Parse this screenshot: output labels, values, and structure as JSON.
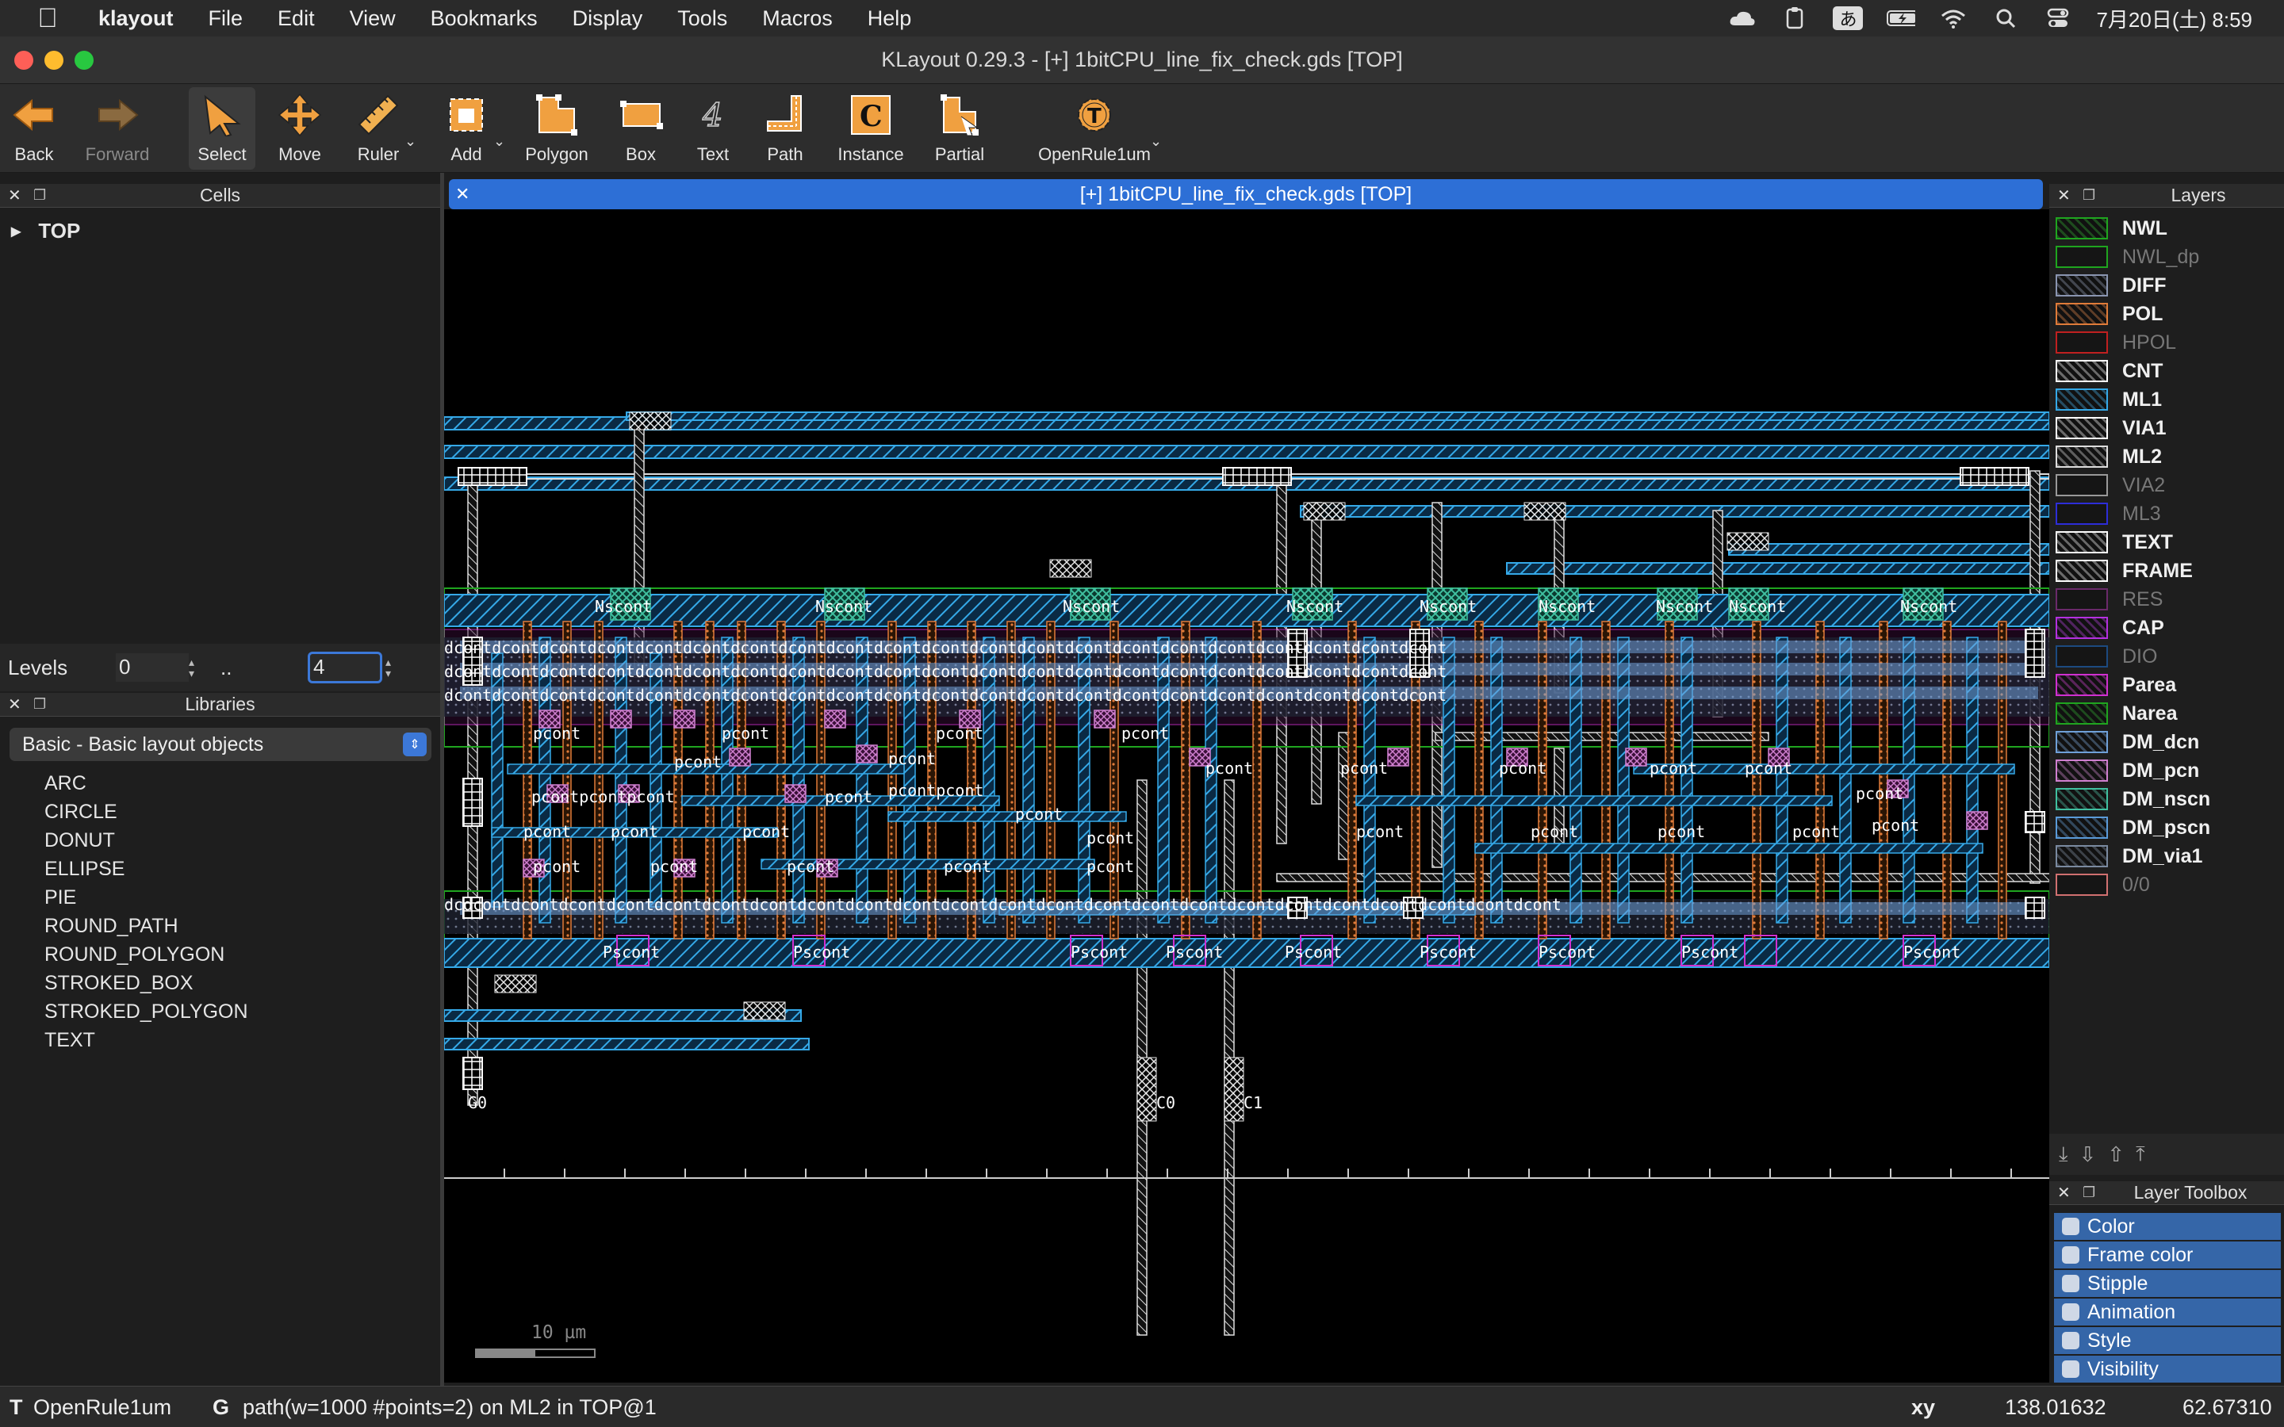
{
  "menubar": {
    "app": "klayout",
    "items": [
      "File",
      "Edit",
      "View",
      "Bookmarks",
      "Display",
      "Tools",
      "Macros",
      "Help"
    ],
    "ime": "あ",
    "clock": "7月20日(土) 8:59"
  },
  "window": {
    "title": "KLayout 0.29.3 - [+] 1bitCPU_line_fix_check.gds [TOP]"
  },
  "toolbar": {
    "back": "Back",
    "forward": "Forward",
    "select": "Select",
    "move": "Move",
    "ruler": "Ruler",
    "add": "Add",
    "polygon": "Polygon",
    "box": "Box",
    "text": "Text",
    "path": "Path",
    "instance": "Instance",
    "partial": "Partial",
    "technology": "OpenRule1um"
  },
  "cells": {
    "title": "Cells",
    "root": "TOP"
  },
  "levels": {
    "label": "Levels",
    "from": "0",
    "sep": "..",
    "to": "4"
  },
  "libraries": {
    "title": "Libraries",
    "selected": "Basic - Basic layout objects",
    "items": [
      "ARC",
      "CIRCLE",
      "DONUT",
      "ELLIPSE",
      "PIE",
      "ROUND_PATH",
      "ROUND_POLYGON",
      "STROKED_BOX",
      "STROKED_POLYGON",
      "TEXT"
    ]
  },
  "canvas": {
    "tab_title": "[+] 1bitCPU_line_fix_check.gds [TOP]",
    "scale_label": "10 µm"
  },
  "layers": {
    "title": "Layers",
    "items": [
      {
        "name": "NWL",
        "color": "#1fa51f",
        "visible": true
      },
      {
        "name": "NWL_dp",
        "color": "#1fa51f",
        "visible": false
      },
      {
        "name": "DIFF",
        "color": "#8a95b0",
        "visible": true
      },
      {
        "name": "POL",
        "color": "#e07b39",
        "visible": true
      },
      {
        "name": "HPOL",
        "color": "#c02020",
        "visible": false
      },
      {
        "name": "CNT",
        "color": "#ffffff",
        "visible": true
      },
      {
        "name": "ML1",
        "color": "#35a9e8",
        "visible": true
      },
      {
        "name": "VIA1",
        "color": "#ffffff",
        "visible": true
      },
      {
        "name": "ML2",
        "color": "#dddddd",
        "visible": true
      },
      {
        "name": "VIA2",
        "color": "#999999",
        "visible": false
      },
      {
        "name": "ML3",
        "color": "#2d2dd8",
        "visible": false
      },
      {
        "name": "TEXT",
        "color": "#ffffff",
        "visible": true
      },
      {
        "name": "FRAME",
        "color": "#ffffff",
        "visible": true
      },
      {
        "name": "RES",
        "color": "#6a2a6a",
        "visible": false
      },
      {
        "name": "CAP",
        "color": "#b430e0",
        "visible": true
      },
      {
        "name": "DIO",
        "color": "#1c4a80",
        "visible": false
      },
      {
        "name": "Parea",
        "color": "#d030d0",
        "visible": true
      },
      {
        "name": "Narea",
        "color": "#1fa51f",
        "visible": true
      },
      {
        "name": "DM_dcn",
        "color": "#6fa0d8",
        "visible": true
      },
      {
        "name": "DM_pcn",
        "color": "#d080d0",
        "visible": true
      },
      {
        "name": "DM_nscn",
        "color": "#40c0a0",
        "visible": true
      },
      {
        "name": "DM_pscn",
        "color": "#5a9ad8",
        "visible": true
      },
      {
        "name": "DM_via1",
        "color": "#7a8aa0",
        "visible": true
      },
      {
        "name": "0/0",
        "color": "#d07070",
        "visible": false
      }
    ]
  },
  "layer_toolbox": {
    "title": "Layer Toolbox",
    "items": [
      "Color",
      "Frame color",
      "Stipple",
      "Animation",
      "Style",
      "Visibility"
    ]
  },
  "status": {
    "tech_key": "T",
    "tech": "OpenRule1um",
    "grid_key": "G",
    "message": "path(w=1000 #points=2) on ML2 in TOP@1",
    "coord_label": "xy",
    "x": "138.01632",
    "y": "62.67310"
  }
}
